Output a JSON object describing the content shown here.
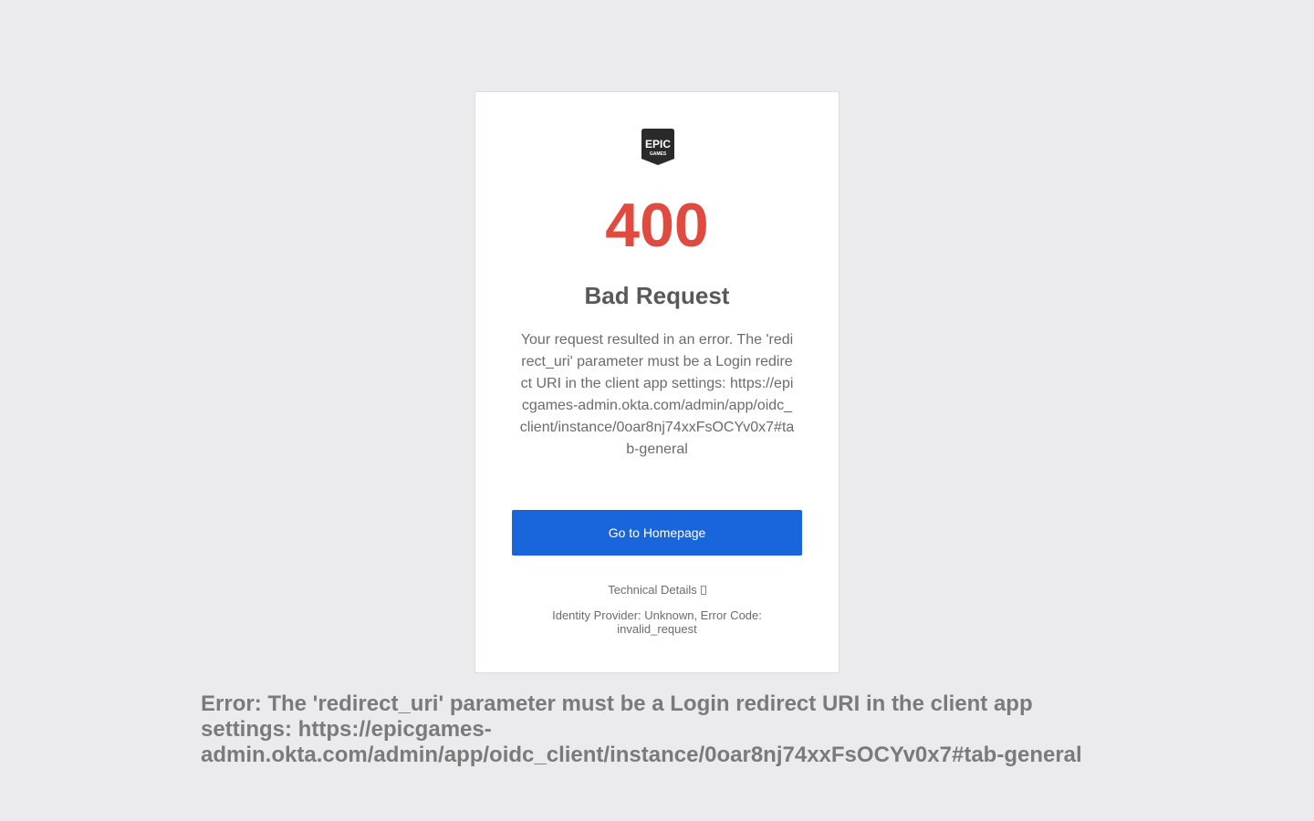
{
  "logo": {
    "name": "epic-games-logo",
    "line1": "EPIC",
    "line2": "GAMES"
  },
  "error": {
    "code": "400",
    "title": "Bad Request",
    "message": "Your request resulted in an error. The 'redirect_uri' parameter must be a Login redirect URI in the client app settings: https://epicgames-admin.okta.com/admin/app/oidc_client/instance/0oar8nj74xxFsOCYv0x7#tab-general"
  },
  "actions": {
    "home_label": "Go to Homepage",
    "tech_details_label": "Technical Details"
  },
  "details": {
    "text": "Identity Provider: Unknown, Error Code: invalid_request"
  },
  "footer": {
    "text": "Error: The 'redirect_uri' parameter must be a Login redirect URI in the client app settings: https://epicgames-admin.okta.com/admin/app/oidc_client/instance/0oar8nj74xxFsOCYv0x7#tab-general"
  },
  "colors": {
    "error_code": "#e04a3f",
    "button": "#1865dc",
    "background": "#ebebed"
  }
}
